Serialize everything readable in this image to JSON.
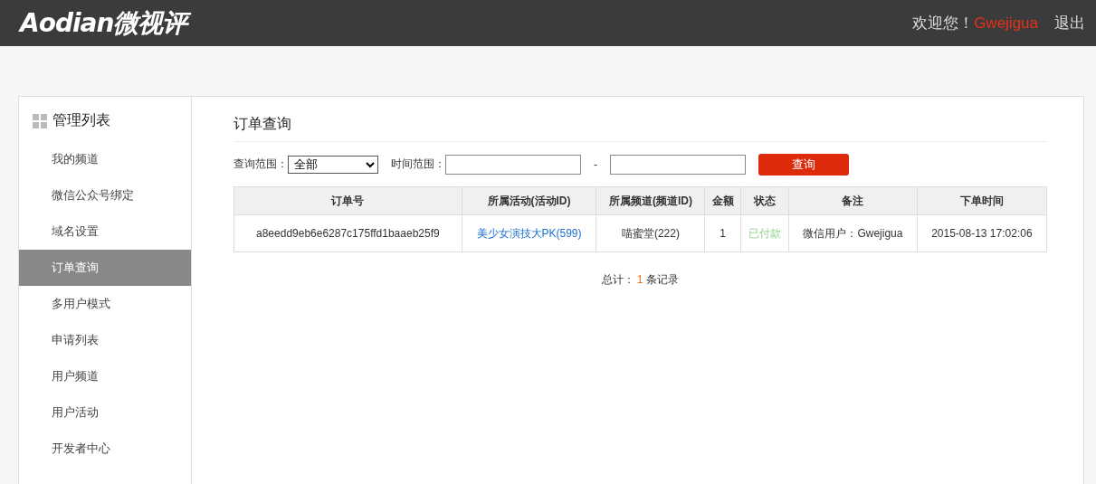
{
  "header": {
    "logo": "Aodian微视评",
    "greeting": "欢迎您！",
    "username": "Gwejigua",
    "logout": "退出"
  },
  "sidebar": {
    "title": "管理列表",
    "items": [
      {
        "label": "我的频道",
        "selected": false
      },
      {
        "label": "微信公众号绑定",
        "selected": false
      },
      {
        "label": "域名设置",
        "selected": false
      },
      {
        "label": "订单查询",
        "selected": true
      },
      {
        "label": "多用户模式",
        "selected": false
      },
      {
        "label": "申请列表",
        "selected": false
      },
      {
        "label": "用户频道",
        "selected": false
      },
      {
        "label": "用户活动",
        "selected": false
      },
      {
        "label": "开发者中心",
        "selected": false
      }
    ]
  },
  "content": {
    "title": "订单查询",
    "filters": {
      "scope_label": "查询范围：",
      "scope_value": "全部",
      "time_label": "时间范围：",
      "separator": "-",
      "button": "查询"
    },
    "table": {
      "columns": [
        "订单号",
        "所属活动(活动ID)",
        "所属频道(频道ID)",
        "金额",
        "状态",
        "备注",
        "下单时间"
      ],
      "rows": [
        [
          {
            "kind": "text",
            "text": "a8eedd9eb6e6287c175ffd1baaeb25f9"
          },
          {
            "kind": "link",
            "text": "美少女演技大PK(599)"
          },
          {
            "kind": "text",
            "text": "喵蜜堂(222)"
          },
          {
            "kind": "text",
            "text": "1"
          },
          {
            "kind": "status",
            "text": "已付款"
          },
          {
            "kind": "text",
            "text": "微信用户：Gwejigua"
          },
          {
            "kind": "text",
            "text": "2015-08-13 17:02:06"
          }
        ]
      ]
    },
    "summary": {
      "prefix": "总计：",
      "count": "1",
      "suffix": "条记录"
    }
  }
}
